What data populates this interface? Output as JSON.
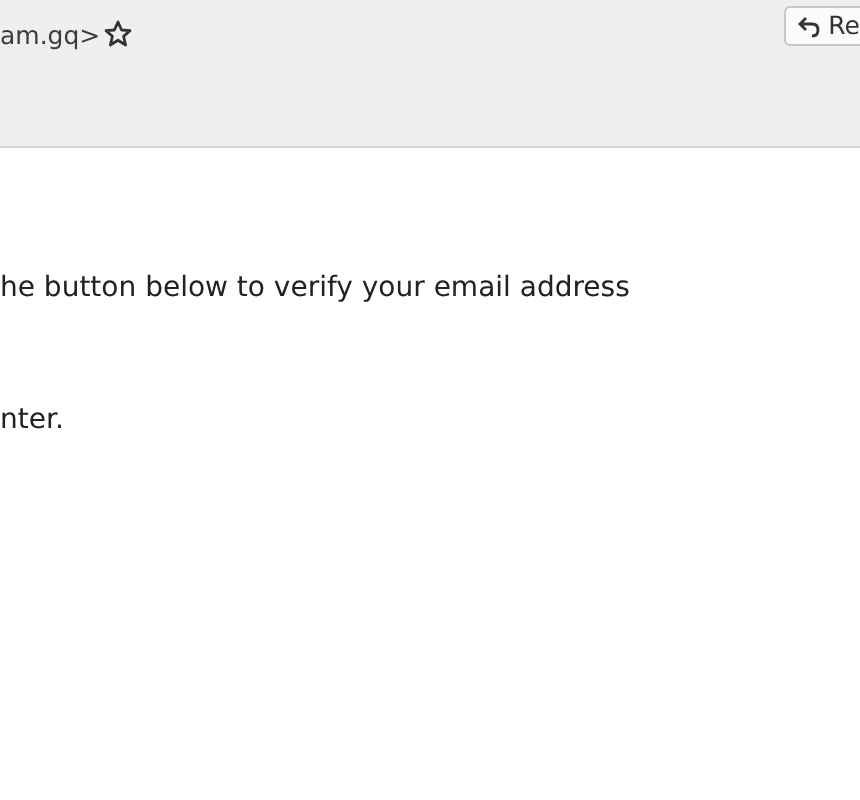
{
  "header": {
    "sender": "am.gq>",
    "starred": false,
    "reply_button": "Re"
  },
  "body": {
    "paragraphs": [
      "he button below to verify your email address",
      "nter."
    ]
  }
}
